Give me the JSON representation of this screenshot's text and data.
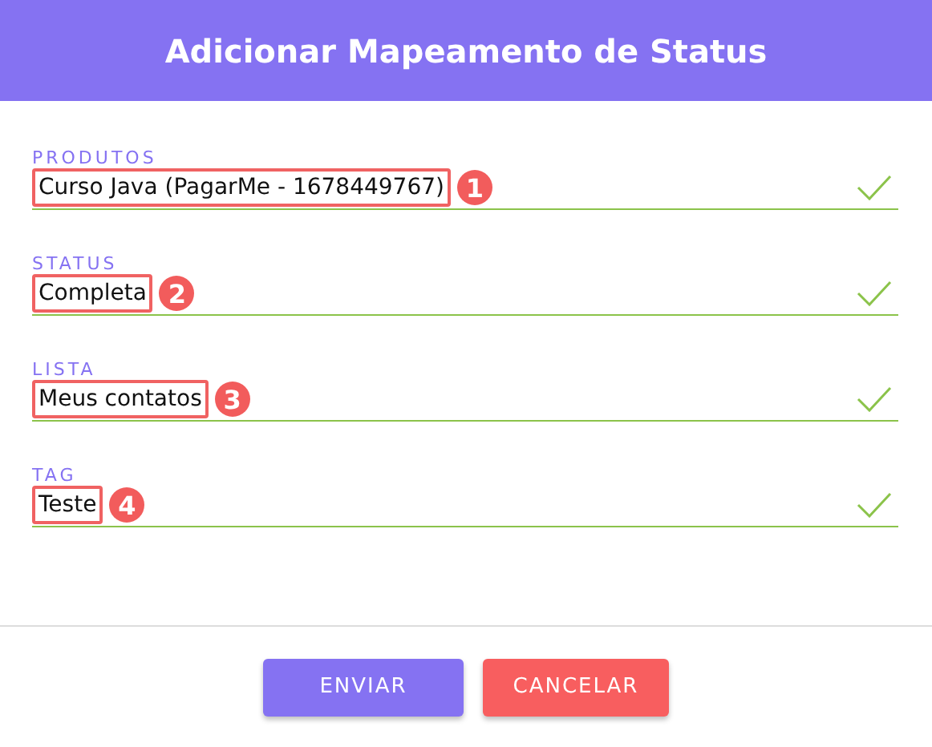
{
  "dialog": {
    "title": "Adicionar Mapeamento de Status"
  },
  "fields": [
    {
      "label": "PRODUTOS",
      "value": "Curso Java (PagarMe - 1678449767)",
      "valid": true,
      "marker": "1"
    },
    {
      "label": "STATUS",
      "value": "Completa",
      "valid": true,
      "marker": "2"
    },
    {
      "label": "LISTA",
      "value": "Meus contatos",
      "valid": true,
      "marker": "3"
    },
    {
      "label": "TAG",
      "value": "Teste",
      "valid": true,
      "marker": "4"
    }
  ],
  "buttons": [
    {
      "label": "ENVIAR",
      "kind": "primary"
    },
    {
      "label": "CANCELAR",
      "kind": "danger"
    }
  ]
}
